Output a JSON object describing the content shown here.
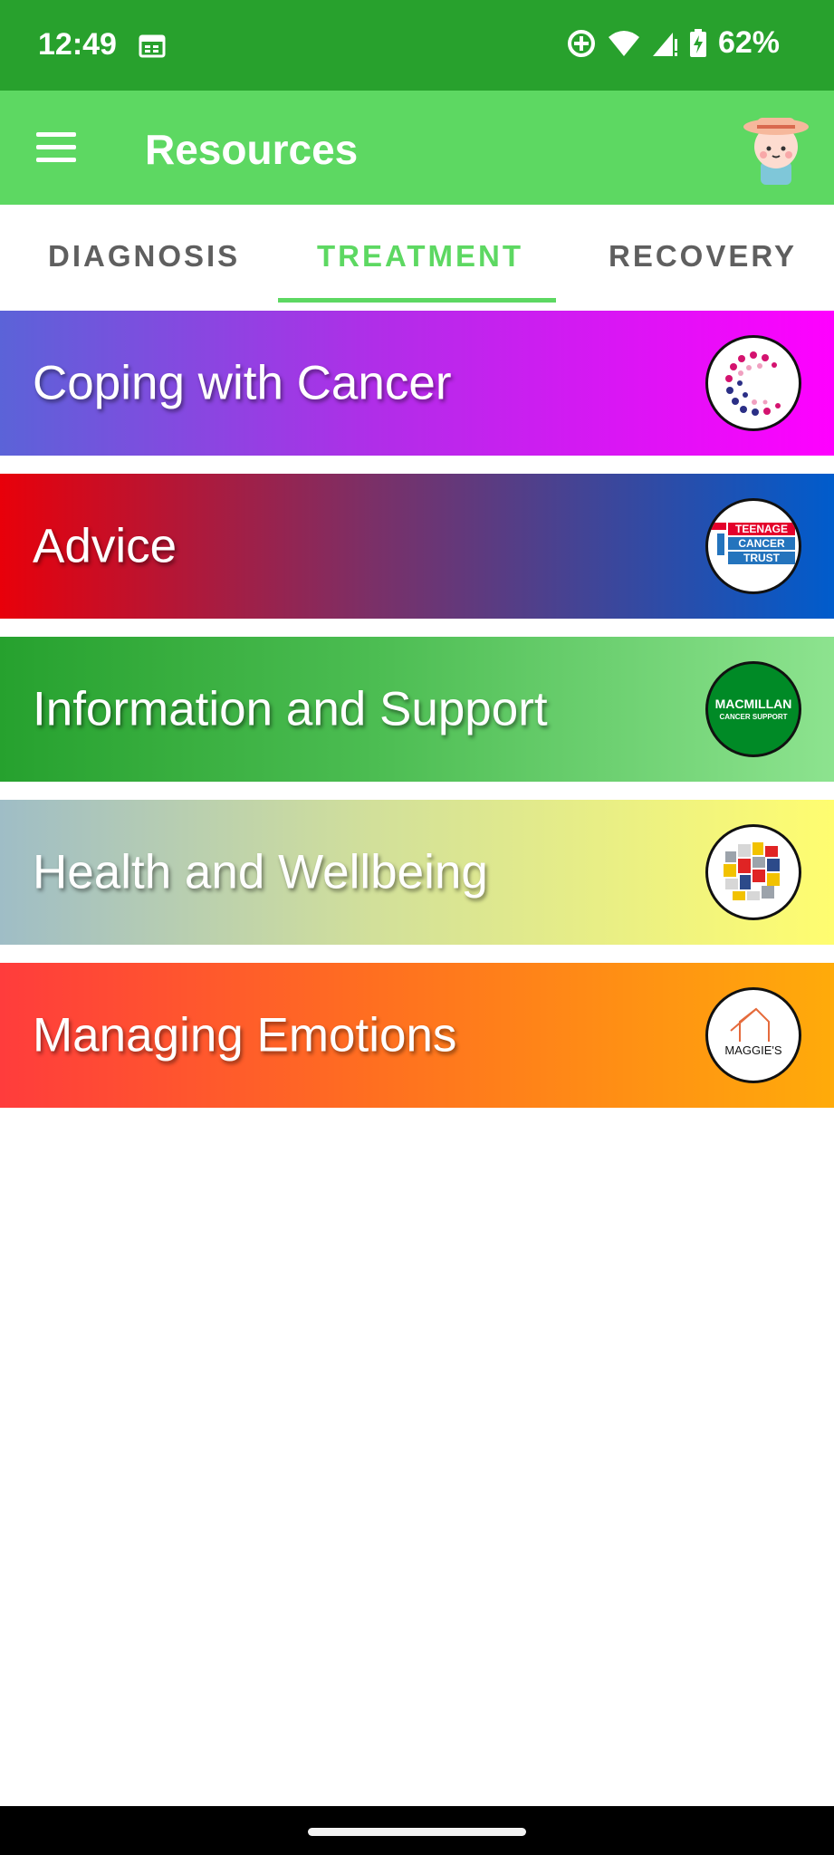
{
  "status_bar": {
    "time": "12:49",
    "battery_percent": "62%",
    "icons": [
      "calendar-icon",
      "data-saver-icon",
      "wifi-icon",
      "cell-signal-icon",
      "battery-charging-icon"
    ]
  },
  "app_bar": {
    "title": "Resources",
    "menu_icon": "hamburger-menu-icon",
    "avatar_icon": "gardener-avatar-icon",
    "background": "#5dd862"
  },
  "tabs": [
    {
      "label": "DIAGNOSIS",
      "active": false
    },
    {
      "label": "TREATMENT",
      "active": true
    },
    {
      "label": "RECOVERY",
      "active": false
    }
  ],
  "resources": [
    {
      "label": "Coping with Cancer",
      "logo": "c-dots-logo",
      "gradient": [
        "#5b63d8",
        "#ff00ff"
      ]
    },
    {
      "label": "Advice",
      "logo": "teenage-cancer-trust-logo",
      "logo_text": [
        "TEENAGE",
        "CANCER",
        "TRUST"
      ],
      "gradient": [
        "#e8000a",
        "#005ccc"
      ]
    },
    {
      "label": "Information and Support",
      "logo": "macmillan-logo",
      "logo_text": [
        "MACMILLAN",
        "CANCER SUPPORT"
      ],
      "gradient": [
        "#26a12e",
        "#8de38f"
      ]
    },
    {
      "label": "Health and Wellbeing",
      "logo": "mosaic-logo",
      "gradient": [
        "#9fbdc6",
        "#fffd70"
      ]
    },
    {
      "label": "Managing Emotions",
      "logo": "maggies-logo",
      "logo_text": [
        "MAGGIE'S"
      ],
      "gradient": [
        "#ff3c3c",
        "#ffab0a"
      ]
    }
  ]
}
